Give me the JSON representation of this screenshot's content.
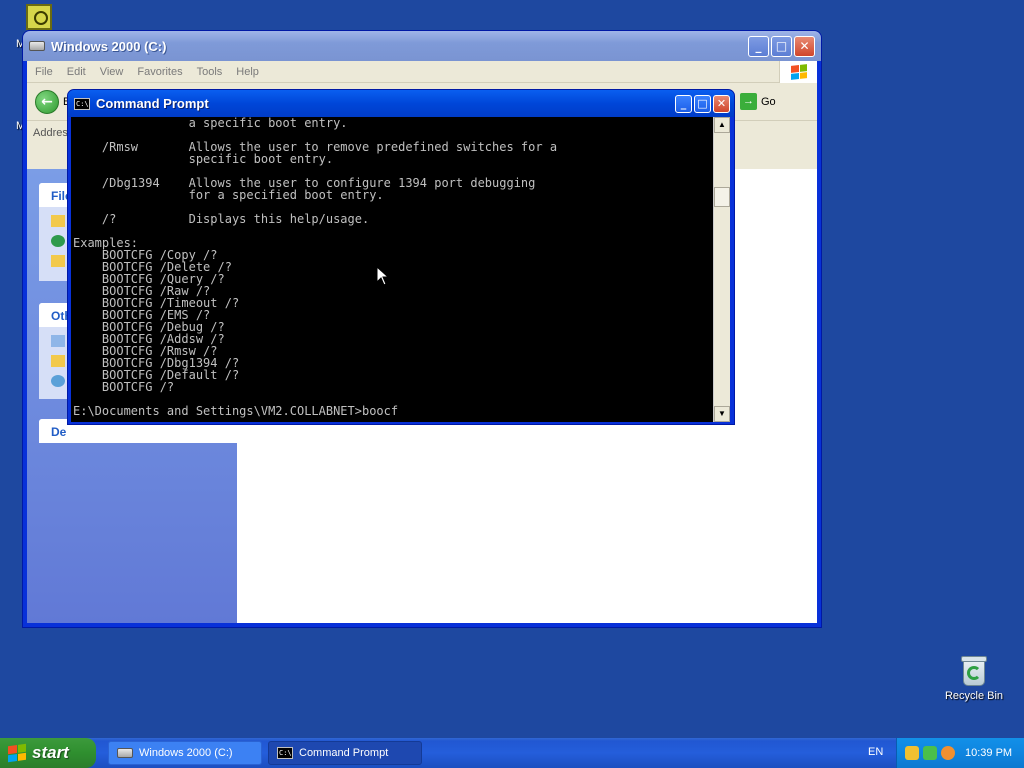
{
  "desktop": {
    "recycle_bin_label": "Recycle Bin",
    "clipped_label_1": "M",
    "clipped_label_2": "M"
  },
  "explorer": {
    "title": "Windows 2000 (C:)",
    "menu": [
      "File",
      "Edit",
      "View",
      "Favorites",
      "Tools",
      "Help"
    ],
    "back_label": "B",
    "address_label": "Addres",
    "go_label": "Go",
    "taskpane": {
      "box1_head": "File",
      "box2_head": "Oth",
      "box3_head": "De"
    }
  },
  "cmd": {
    "title": "Command Prompt",
    "lines": [
      "                a specific boot entry.",
      "",
      "    /Rmsw       Allows the user to remove predefined switches for a",
      "                specific boot entry.",
      "",
      "    /Dbg1394    Allows the user to configure 1394 port debugging",
      "                for a specified boot entry.",
      "",
      "    /?          Displays this help/usage.",
      "",
      "Examples:",
      "    BOOTCFG /Copy /?",
      "    BOOTCFG /Delete /?",
      "    BOOTCFG /Query /?",
      "    BOOTCFG /Raw /?",
      "    BOOTCFG /Timeout /?",
      "    BOOTCFG /EMS /?",
      "    BOOTCFG /Debug /?",
      "    BOOTCFG /Addsw /?",
      "    BOOTCFG /Rmsw /?",
      "    BOOTCFG /Dbg1394 /?",
      "    BOOTCFG /Default /?",
      "    BOOTCFG /?",
      "",
      "E:\\Documents and Settings\\VM2.COLLABNET>boocf"
    ]
  },
  "taskbar": {
    "start_label": "start",
    "tasks": [
      {
        "label": "Windows 2000 (C:)"
      },
      {
        "label": "Command Prompt"
      }
    ],
    "language": "EN",
    "clock": "10:39 PM"
  },
  "colors": {
    "desktop_bg": "#1e48a0",
    "console_bg": "#000000",
    "console_text": "#c0c0c0",
    "start_green": "#2f8f2f"
  }
}
